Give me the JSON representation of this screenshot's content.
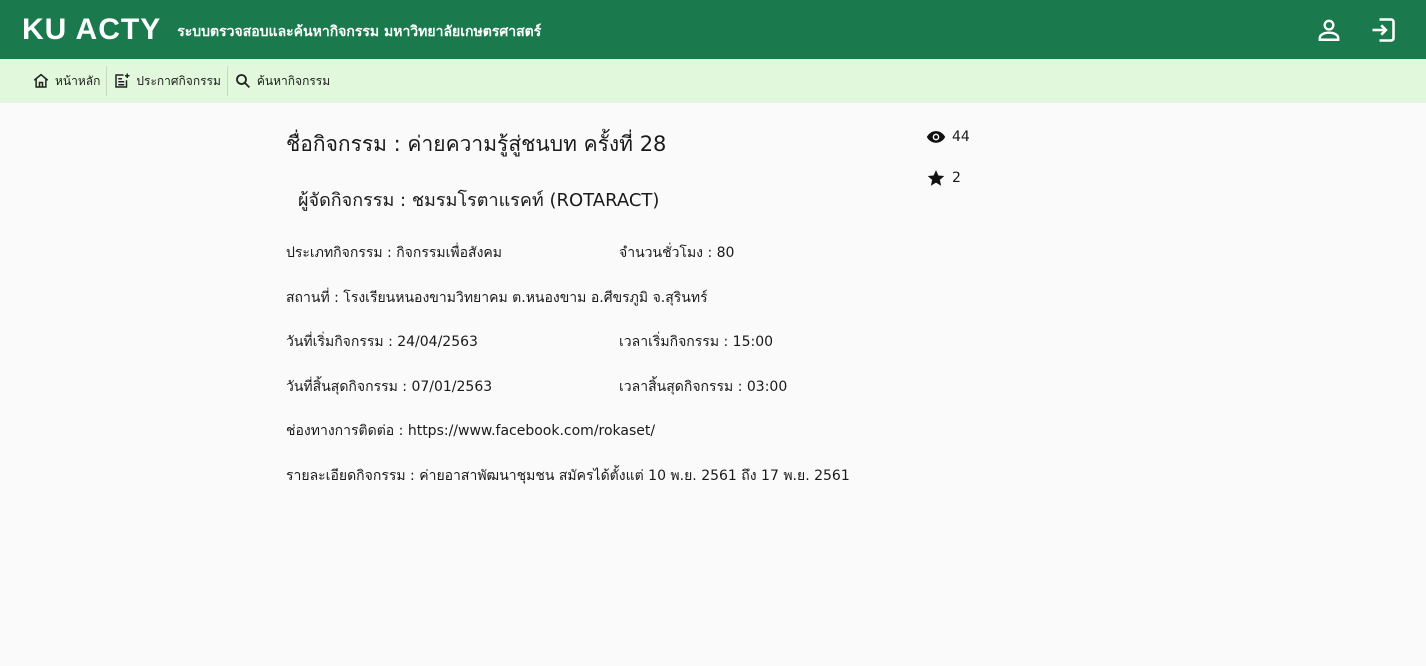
{
  "header": {
    "brand": "KU ACTY",
    "subtitle": "ระบบตรวจสอบและค้นหากิจกรรม มหาวิทยาลัยเกษตรศาสตร์"
  },
  "nav": {
    "home": "หน้าหลัก",
    "announce": "ประกาศกิจกรรม",
    "search": "ค้นหากิจกรรม"
  },
  "activity": {
    "title": "ชื่อกิจกรรม : ค่ายความรู้สู่ชนบท ครั้งที่ 28",
    "organizer": "ผู้จัดกิจกรรม : ชมรมโรตาแรคท์ (ROTARACT)",
    "type": "ประเภทกิจกรรม : กิจกรรมเพื่อสังคม",
    "hours": "จำนวนชั่วโมง : 80",
    "location": "สถานที่ : โรงเรียนหนองขามวิทยาคม ต.หนองขาม อ.ศีขรภูมิ จ.สุรินทร์",
    "start_date": "วันที่เริ่มกิจกรรม : 24/04/2563",
    "start_time": "เวลาเริ่มกิจกรรม : 15:00",
    "end_date": "วันที่สิ้นสุดกิจกรรม : 07/01/2563",
    "end_time": "เวลาสิ้นสุดกิจกรรม : 03:00",
    "contact": "ช่องทางการติดต่อ : https://www.facebook.com/rokaset/",
    "detail": "รายละเอียดกิจกรรม : ค่ายอาสาพัฒนาชุมชน สมัครได้ตั้งแต่ 10 พ.ย. 2561 ถึง 17 พ.ย. 2561"
  },
  "stats": {
    "views": "44",
    "stars": "2"
  },
  "colors": {
    "header_bg": "#1a7a4d",
    "nav_bg": "#e2f8dc",
    "page_bg": "#fafafa"
  },
  "icons": {
    "profile": "user-icon",
    "logout": "logout-icon",
    "home": "home-icon",
    "announce": "post-add-icon",
    "search": "search-icon",
    "views": "eye-icon",
    "stars": "star-icon"
  }
}
